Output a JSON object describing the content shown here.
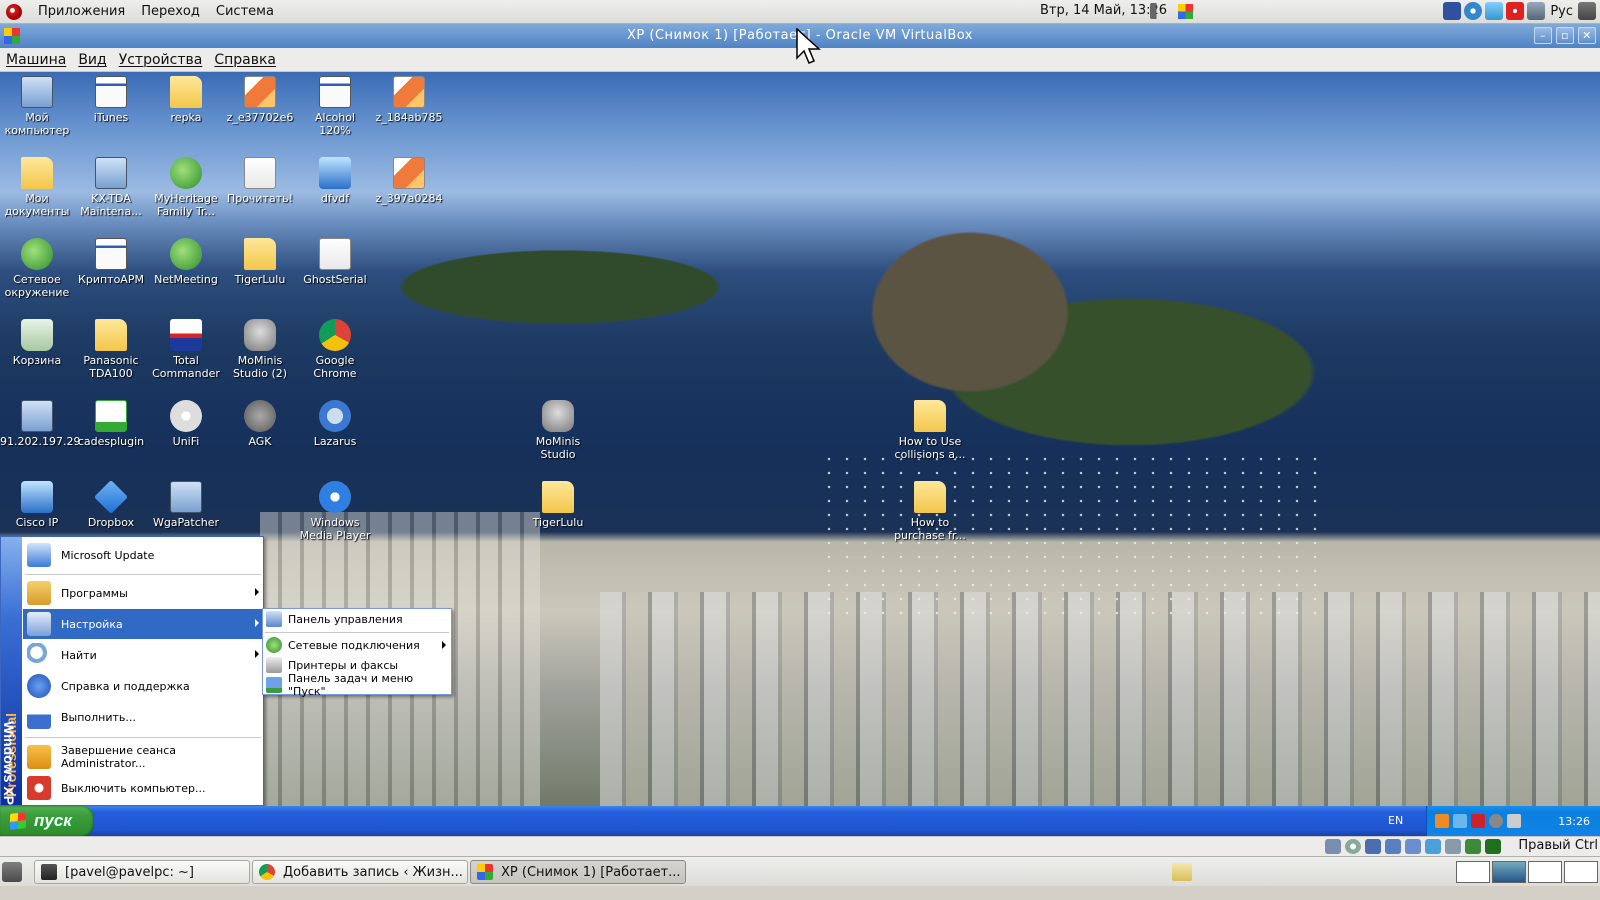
{
  "gnome_top": {
    "menus": [
      "Приложения",
      "Переход",
      "Система"
    ],
    "clock": "Втр, 14 Май, 13:26",
    "keyboard_layout": "Рус"
  },
  "vbox": {
    "title": "XP (Снимок 1) [Работает] - Oracle VM VirtualBox",
    "menus": [
      "Машина",
      "Вид",
      "Устройства",
      "Справка"
    ],
    "host_key": "Правый Ctrl"
  },
  "desktop_icons": [
    {
      "label": "Мой компьютер",
      "icon": "my-computer-icon"
    },
    {
      "label": "iTunes",
      "icon": "itunes-icon"
    },
    {
      "label": "repka",
      "icon": "folder-icon"
    },
    {
      "label": "z_e37702e6",
      "icon": "image-file-icon"
    },
    {
      "label": "Alcohol 120%",
      "icon": "alcohol-icon"
    },
    {
      "label": "z_184ab785",
      "icon": "image-file-icon"
    },
    {
      "label": "Мои документы",
      "icon": "my-documents-icon"
    },
    {
      "label": "KX-TDA Maintena...",
      "icon": "kx-tda-icon"
    },
    {
      "label": "MyHeritage Family Tr...",
      "icon": "myheritage-icon"
    },
    {
      "label": "Прочитать!",
      "icon": "text-file-icon"
    },
    {
      "label": "dfvdf",
      "icon": "network-share-icon"
    },
    {
      "label": "z_397a0284",
      "icon": "image-file-icon"
    },
    {
      "label": "Сетевое окружение",
      "icon": "network-places-icon"
    },
    {
      "label": "КриптоАРМ",
      "icon": "cryptoarm-icon"
    },
    {
      "label": "NetMeeting",
      "icon": "netmeeting-icon"
    },
    {
      "label": "TigerLulu",
      "icon": "zip-folder-icon"
    },
    {
      "label": "GhostSerial",
      "icon": "text-file-icon"
    },
    {
      "label": "Корзина",
      "icon": "recycle-bin-icon"
    },
    {
      "label": "Panasonic TDA100",
      "icon": "folder-icon"
    },
    {
      "label": "Total Commander",
      "icon": "total-commander-icon"
    },
    {
      "label": "MoMinis Studio (2)",
      "icon": "mominis-icon"
    },
    {
      "label": "Google Chrome",
      "icon": "chrome-icon"
    },
    {
      "label": "91.202.197.29",
      "icon": "remote-desktop-icon"
    },
    {
      "label": "cadesplugin",
      "icon": "certificate-icon"
    },
    {
      "label": "UniFi",
      "icon": "unifi-icon"
    },
    {
      "label": "AGK",
      "icon": "agk-icon"
    },
    {
      "label": "Lazarus",
      "icon": "lazarus-icon"
    },
    {
      "label": "MoMinis Studio",
      "icon": "mominis-icon"
    },
    {
      "label": "How to Use collisions a...",
      "icon": "folder-icon"
    },
    {
      "label": "Cisco IP",
      "icon": "cisco-icon"
    },
    {
      "label": "Dropbox",
      "icon": "dropbox-icon"
    },
    {
      "label": "WgaPatcher",
      "icon": "wgapatcher-icon"
    },
    {
      "label": "Windows Media Player",
      "icon": "media-player-icon"
    },
    {
      "label": "TigerLulu",
      "icon": "folder-icon"
    },
    {
      "label": "How to purchase fr...",
      "icon": "folder-icon"
    }
  ],
  "start_menu": {
    "banner_brand": "Windows XP",
    "banner_edition": "Professional",
    "items": [
      {
        "label": "Microsoft Update",
        "icon": "microsoft-update-icon",
        "submenu": false
      },
      {
        "label": "Программы",
        "icon": "programs-icon",
        "submenu": true
      },
      {
        "label": "Настройка",
        "icon": "settings-icon",
        "submenu": true,
        "active": true
      },
      {
        "label": "Найти",
        "icon": "search-icon",
        "submenu": true
      },
      {
        "label": "Справка и поддержка",
        "icon": "help-icon",
        "submenu": false
      },
      {
        "label": "Выполнить...",
        "icon": "run-icon",
        "submenu": false
      },
      {
        "label": "Завершение сеанса Administrator...",
        "icon": "logoff-icon",
        "submenu": false
      },
      {
        "label": "Выключить компьютер...",
        "icon": "shutdown-icon",
        "submenu": false
      }
    ],
    "settings_submenu": [
      {
        "label": "Панель управления",
        "icon": "control-panel-icon",
        "submenu": false
      },
      {
        "label": "Сетевые подключения",
        "icon": "network-connections-icon",
        "submenu": true
      },
      {
        "label": "Принтеры и факсы",
        "icon": "printers-icon",
        "submenu": false
      },
      {
        "label": "Панель задач и меню \"Пуск\"",
        "icon": "taskbar-icon",
        "submenu": false
      }
    ]
  },
  "xp_taskbar": {
    "start_label": "пуск",
    "language": "EN",
    "time": "13:26"
  },
  "gnome_bottom": {
    "tasks": [
      {
        "label": "[pavel@pavelpc: ~]",
        "icon": "terminal-icon",
        "active": false
      },
      {
        "label": "Добавить запись ‹ Жизн...",
        "icon": "chrome-icon",
        "active": false
      },
      {
        "label": "XP (Снимок 1) [Работает...",
        "icon": "virtualbox-icon",
        "active": true
      }
    ]
  },
  "colors": {
    "xp_blue": "#245edb",
    "xp_start_green": "#3e9e3e",
    "menu_highlight": "#316ac5",
    "vbox_title": "#4f83c4"
  }
}
